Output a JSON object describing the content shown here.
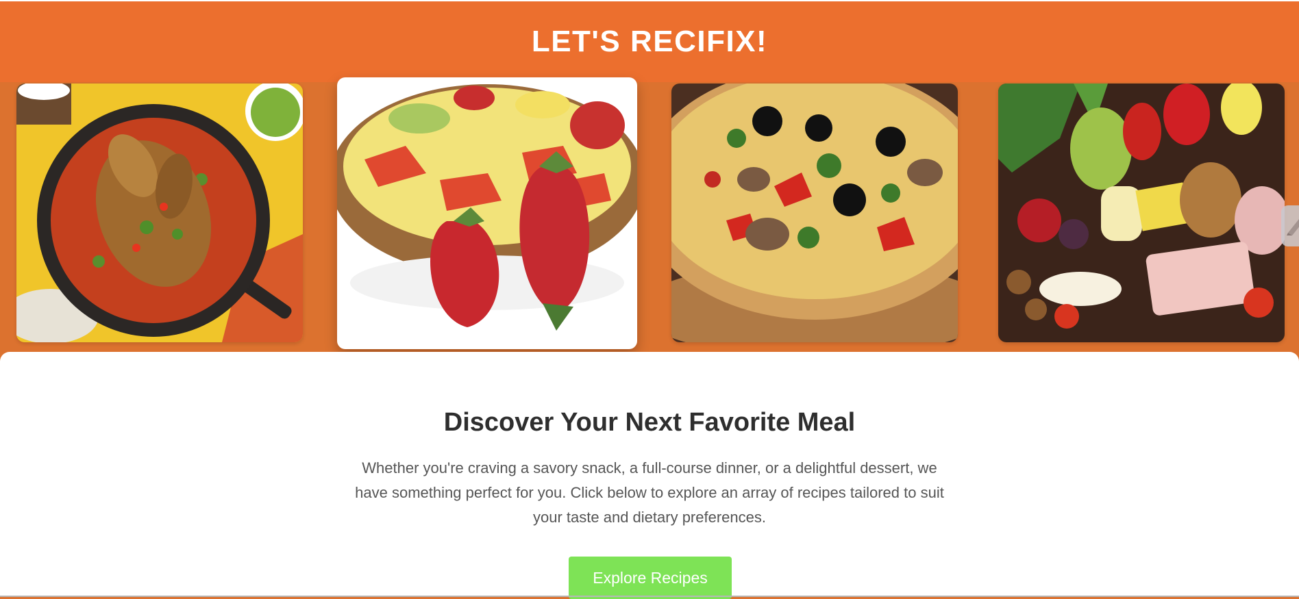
{
  "header": {
    "title": "LET'S RECIFIX!"
  },
  "gallery": [
    {
      "name": "roast-chicken-skillet-image"
    },
    {
      "name": "strawberry-tart-image"
    },
    {
      "name": "pizza-image"
    },
    {
      "name": "fruit-cheese-platter-image"
    }
  ],
  "main": {
    "heading": "Discover Your Next Favorite Meal",
    "description": "Whether you're craving a savory snack, a full-course dinner, or a delightful dessert, we have something perfect for you. Click below to explore an array of recipes tailored to suit your taste and dietary preferences.",
    "cta_label": "Explore Recipes"
  },
  "colors": {
    "header_bg": "#ec6f2e",
    "page_bg": "#dc722f",
    "button_bg": "#7ee356"
  }
}
